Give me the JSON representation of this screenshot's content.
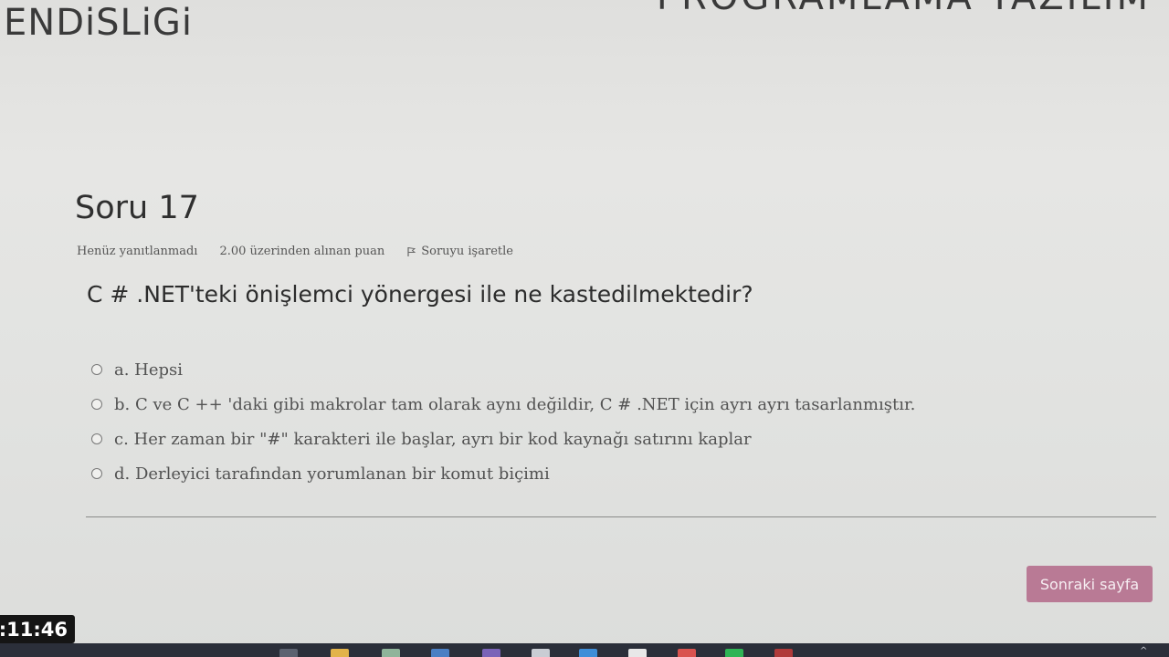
{
  "header": {
    "left_text": "ENDiSLiGi",
    "right_text": "PROGRAMLAMA YAZILIM"
  },
  "question": {
    "title": "Soru 17",
    "status": "Henüz yanıtlanmadı",
    "points": "2.00 üzerinden alınan puan",
    "flag_label": "Soruyu işaretle",
    "text": "C # .NET'teki önişlemci yönergesi ile ne kastedilmektedir?",
    "answers": [
      "a. Hepsi",
      "b. C ve C ++ 'daki gibi makrolar tam olarak aynı değildir, C # .NET için ayrı ayrı tasarlanmıştır.",
      "c. Her zaman bir \"#\" karakteri ile başlar, ayrı bir kod kaynağı satırını kaplar",
      "d. Derleyici tarafından yorumlanan bir komut biçimi"
    ]
  },
  "nav": {
    "next_label": "Sonraki sayfa"
  },
  "timer": {
    "value": ":11:46"
  },
  "taskbar": {
    "icons": [
      "task-view-icon",
      "file-explorer-icon",
      "app-icon",
      "store-icon",
      "visual-studio-icon",
      "app-icon-2",
      "browser-icon",
      "document-icon",
      "chrome-icon",
      "spotify-icon",
      "app-icon-3"
    ],
    "chevron": "^"
  },
  "colors": {
    "button": "#b97a95",
    "background": "#e4e4e2",
    "timer_bg": "#151515",
    "taskbar": "#2b2f3a"
  }
}
